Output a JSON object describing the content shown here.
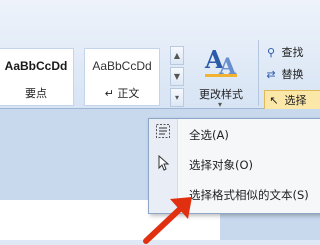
{
  "styles": {
    "items": [
      {
        "sample": "AaBbCcDd",
        "name": "要点"
      },
      {
        "sample": "AaBbCcDd",
        "name": "正文",
        "prefix": "↵"
      }
    ],
    "change_styles_label": "更改样式"
  },
  "editing": {
    "find_label": "查找",
    "replace_label": "替换",
    "select_label": "选择"
  },
  "select_menu": {
    "items": [
      {
        "label": "全选(A)",
        "icon": "select-all-icon"
      },
      {
        "label": "选择对象(O)",
        "icon": "cursor-icon"
      },
      {
        "label": "选择格式相似的文本(S)",
        "icon": ""
      }
    ]
  },
  "colors": {
    "accent": "#2a5aa8",
    "arrow": "#e03010",
    "highlight": "#fbe7a8"
  }
}
